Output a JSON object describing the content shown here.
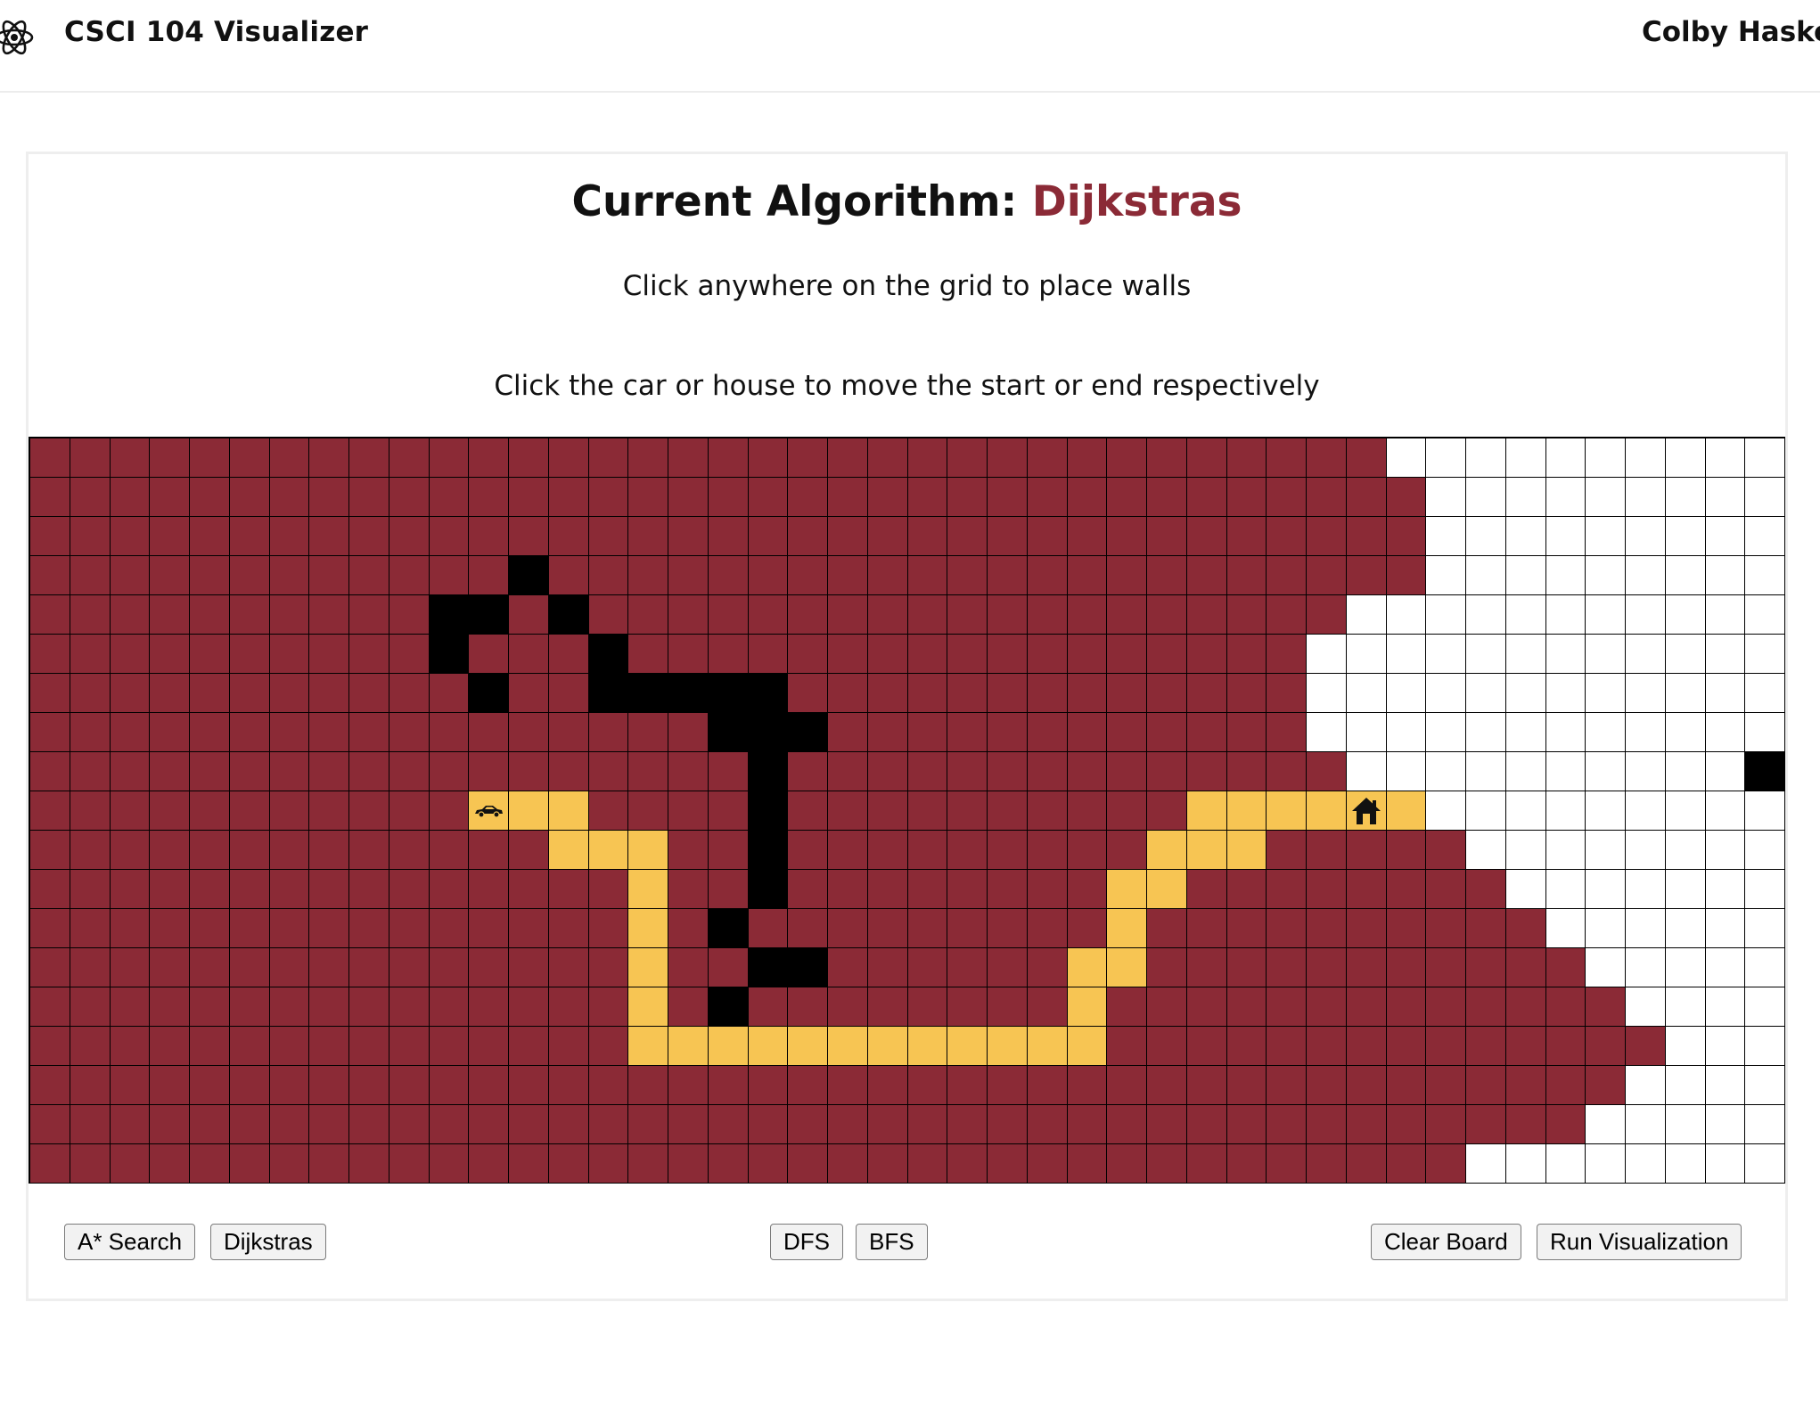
{
  "navbar": {
    "app_title": "CSCI 104 Visualizer",
    "author": "Colby Haskel"
  },
  "header": {
    "prefix": "Current Algorithm:",
    "algorithm": "Dijkstras"
  },
  "instructions": {
    "walls": "Click anywhere on the grid to place walls",
    "move": "Click the car or house to move the start or end respectively"
  },
  "colors": {
    "visited": "#8b2a36",
    "unvisited": "#ffffff",
    "wall": "#000000",
    "path": "#f7c553"
  },
  "grid": {
    "cols": 44,
    "rows": [
      "11111111111111111111111111111111110000000000",
      "11111111111111111111111111111111111000000000",
      "11111111111111111111111111111111111000000000",
      "11111111111121111111111111111111111000000000",
      "11111111112212111111111111111111100000000000",
      "11111111112111211111111111111111000000000000",
      "11111111111211222221111111111111000000000000",
      "11111111111111111222111111111111000000000000",
      "11111111111111111121111111111111100000000002",
      "11111111111333111121111111111333333000000000",
      "11111111111113331121111111113331111100000000",
      "11111111111111131121111111133111111110000000",
      "11111111111111131211111111131111111111000000",
      "11111111111111131122111111331111111111100000",
      "11111111111111131211111111311111111111110000",
      "11111111111111133333333333311111111111111000",
      "11111111111111111111111111111111111111110000",
      "11111111111111111111111111111111111111100000",
      "11111111111111111111111111111111111100000000"
    ],
    "start": {
      "row": 9,
      "col": 11,
      "icon": "car-icon"
    },
    "end": {
      "row": 9,
      "col": 33,
      "icon": "house-icon"
    }
  },
  "buttons": {
    "astar": "A* Search",
    "dijkstras": "Dijkstras",
    "dfs": "DFS",
    "bfs": "BFS",
    "clear": "Clear Board",
    "run": "Run Visualization"
  }
}
